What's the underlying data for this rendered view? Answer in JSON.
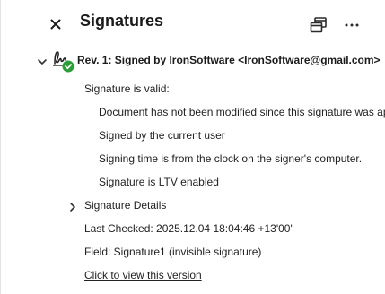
{
  "header": {
    "title": "Signatures",
    "close_icon": "close-icon",
    "copy_icon": "copy-windows-icon",
    "more_icon": "more-horizontal-icon"
  },
  "signature": {
    "title": "Rev. 1: Signed by IronSoftware <IronSoftware@gmail.com>",
    "status_icon": "signature-valid-icon",
    "valid_color": "#2d9d3a",
    "validity": "Signature is valid:",
    "details": [
      "Document has not been modified since this signature was applied",
      "Signed by the current user",
      "Signing time is from the clock on the signer's computer.",
      "Signature is LTV enabled"
    ],
    "details_label": "Signature Details",
    "last_checked": "Last Checked: 2025.12.04 18:04:46 +13'00'",
    "field": "Field: Signature1 (invisible signature)",
    "view_link": "Click to view this version"
  }
}
